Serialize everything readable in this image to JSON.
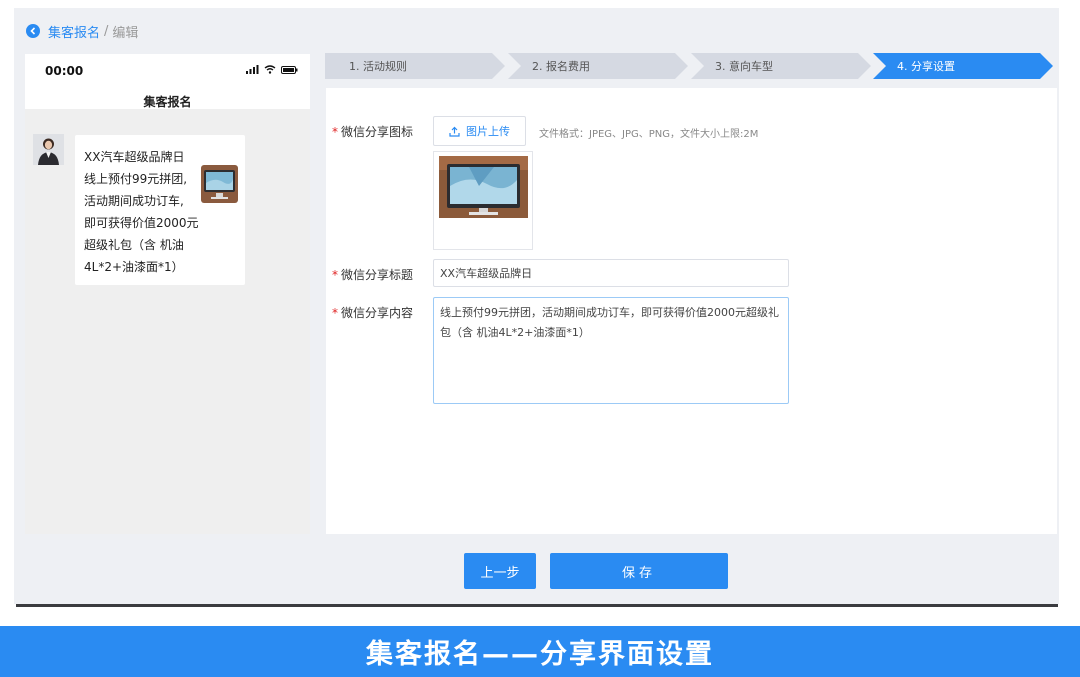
{
  "breadcrumb": {
    "link": "集客报名",
    "separator": "/",
    "current": "编辑"
  },
  "phone": {
    "time": "00:00",
    "title": "集客报名",
    "message_lines": [
      "XX汽车超级品牌日",
      "线上预付99元拼团,",
      "活动期间成功订车,",
      "即可获得价值2000元",
      "超级礼包（含 机油",
      "4L*2+油漆面*1）"
    ]
  },
  "steps": [
    {
      "label": "1. 活动规则",
      "active": false
    },
    {
      "label": "2. 报名费用",
      "active": false
    },
    {
      "label": "3. 意向车型",
      "active": false
    },
    {
      "label": "4. 分享设置",
      "active": true
    }
  ],
  "form": {
    "required_mark": "*",
    "icon_label": "微信分享图标",
    "upload_label": "图片上传",
    "upload_hint": "文件格式：JPEG、JPG、PNG，文件大小上限:2M",
    "title_label": "微信分享标题",
    "title_value": "XX汽车超级品牌日",
    "content_label": "微信分享内容",
    "content_value": "线上预付99元拼团，活动期间成功订车，即可获得价值2000元超级礼包（含 机油4L*2+油漆面*1）"
  },
  "actions": {
    "prev_label": "上一步",
    "save_label": "保存"
  },
  "banner": {
    "text": "集客报名——分享界面设置"
  },
  "colors": {
    "accent": "#2a8bf2",
    "step_inactive": "#d5d9e2",
    "required": "#e02424"
  }
}
